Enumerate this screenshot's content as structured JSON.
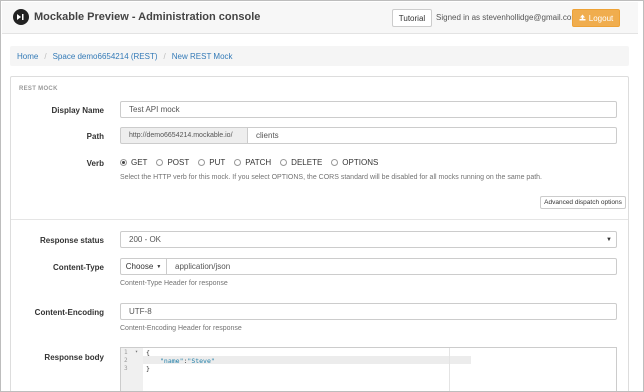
{
  "navbar": {
    "title": "Mockable Preview - Administration console",
    "tutorial_label": "Tutorial",
    "signed_in_text": "Signed in as stevenhollidge@gmail.com",
    "logout_label": "Logout"
  },
  "breadcrumb": {
    "home": "Home",
    "space": "Space demo6654214 (REST)",
    "current": "New REST Mock"
  },
  "panel": {
    "heading": "REST MOCK"
  },
  "form": {
    "display_name_label": "Display Name",
    "display_name_value": "Test API mock",
    "path_label": "Path",
    "path_prefix": "http://demo6654214.mockable.io/",
    "path_value": "clients",
    "verb_label": "Verb",
    "verbs": [
      "GET",
      "POST",
      "PUT",
      "PATCH",
      "DELETE",
      "OPTIONS"
    ],
    "selected_verb": "GET",
    "verb_help": "Select the HTTP verb for this mock. If you select OPTIONS, the CORS standard will be disabled for all mocks running on the same path.",
    "advanced_dispatch_label": "Advanced dispatch options",
    "response_status_label": "Response status",
    "response_status_value": "200 - OK",
    "content_type_label": "Content-Type",
    "choose_label": "Choose",
    "content_type_value": "application/json",
    "content_type_help": "Content-Type Header for response",
    "content_encoding_label": "Content-Encoding",
    "content_encoding_value": "UTF-8",
    "content_encoding_help": "Content-Encoding Header for response",
    "response_body_label": "Response body",
    "body_lines": [
      "1",
      "2",
      "3"
    ],
    "body_code": {
      "line1": "{",
      "line2_key": "\"name\"",
      "line2_sep": ":",
      "line2_val": "\"Steve\"",
      "line3": "}"
    }
  }
}
